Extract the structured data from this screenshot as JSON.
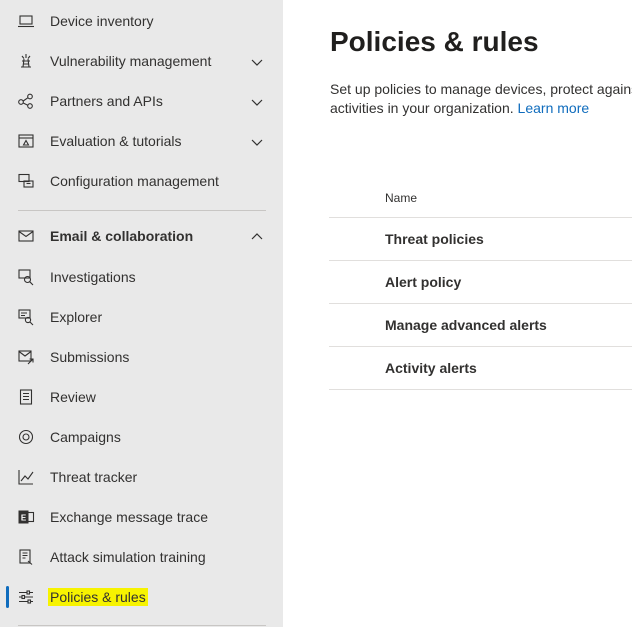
{
  "sidebar": {
    "items": [
      {
        "label": "Device inventory",
        "icon": "laptop-icon"
      },
      {
        "label": "Vulnerability management",
        "icon": "vulnerability-icon",
        "expandable": true
      },
      {
        "label": "Partners and APIs",
        "icon": "partners-icon",
        "expandable": true
      },
      {
        "label": "Evaluation & tutorials",
        "icon": "evaluation-icon",
        "expandable": true
      },
      {
        "label": "Configuration management",
        "icon": "configuration-icon"
      }
    ],
    "section": {
      "label": "Email & collaboration",
      "icon": "mail-icon",
      "expanded": true
    },
    "sub_items": [
      {
        "label": "Investigations",
        "icon": "investigations-icon"
      },
      {
        "label": "Explorer",
        "icon": "explorer-icon"
      },
      {
        "label": "Submissions",
        "icon": "submissions-icon"
      },
      {
        "label": "Review",
        "icon": "review-icon"
      },
      {
        "label": "Campaigns",
        "icon": "campaigns-icon"
      },
      {
        "label": "Threat tracker",
        "icon": "threat-tracker-icon"
      },
      {
        "label": "Exchange message trace",
        "icon": "exchange-icon"
      },
      {
        "label": "Attack simulation training",
        "icon": "attack-simulation-icon"
      },
      {
        "label": "Policies & rules",
        "icon": "policies-icon",
        "active": true,
        "highlight_color": "#f7f300"
      }
    ],
    "active_color": "#0f6cbd"
  },
  "main": {
    "title": "Policies & rules",
    "description_line1": "Set up policies to manage devices, protect agains",
    "description_line2": "activities in your organization.",
    "learn_more": "Learn more",
    "table": {
      "header": "Name",
      "rows": [
        "Threat policies",
        "Alert policy",
        "Manage advanced alerts",
        "Activity alerts"
      ]
    }
  }
}
